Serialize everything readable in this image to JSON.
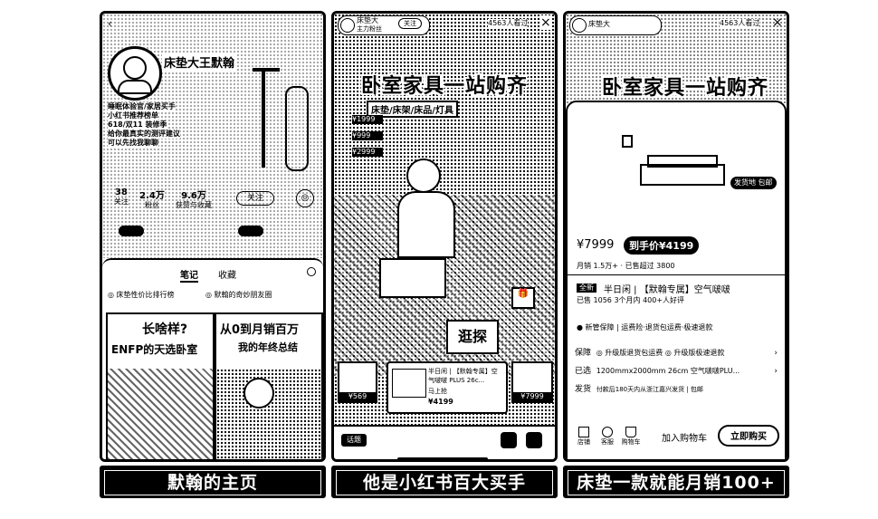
{
  "left": {
    "profile_name": "床垫大王默翰",
    "bio_lines": [
      "睡眠体验官/家居买手",
      "小红书推荐榜单",
      "618/双11 装修季",
      "给你最真实的测评建议",
      "可以先找我聊聊"
    ],
    "stats": [
      {
        "value": "38",
        "label": "关注"
      },
      {
        "value": "2.4万",
        "label": "粉丝"
      },
      {
        "value": "9.6万",
        "label": "获赞与收藏"
      }
    ],
    "follow_label": "关注",
    "chat_label": "◎",
    "tabs": [
      "笔记",
      "收藏"
    ],
    "pinned": [
      "床垫性价比排行榜",
      "默翰的奇妙朋友圈"
    ],
    "card1_text1": "长啥样?",
    "card1_text2": "ENFP的天选卧室",
    "card2_text1": "从0到月销百万",
    "card2_text2": "我的年终总结"
  },
  "middle": {
    "host_name": "床垫大",
    "host_sub": "主力粉丝",
    "follow_label": "关注",
    "viewers": "4563人看过",
    "close_icon": "×",
    "banner": "卧室家具一站购齐",
    "subbanner": "床垫/床架/床品/灯具",
    "price_tags": [
      "¥1999",
      "¥999",
      "¥2999"
    ],
    "sticker": "逛探",
    "product_title": "半日闲 | 【默翰专属】空气啵啵 PLUS 26c...",
    "product_price": "¥4199",
    "product_buy": "马上抢",
    "left_price": "¥569",
    "right_price": "¥7999",
    "bottom_tab": "话题"
  },
  "right": {
    "host_name": "床垫大",
    "viewers": "4563人看过",
    "banner": "卧室家具一站购齐",
    "tag_label": "发货地 包邮",
    "price_original": "¥7999",
    "price_sale": "到手价¥4199",
    "sales_row": "月销 1.5万+ · 已售超过 3800",
    "shop_badge": "全新",
    "product_title": "半日闲 | 【默翰专属】空气啵啵",
    "sold_row": "已售 1056   3个月内 400+人好评",
    "guarantee": "新管保障 | 运费险·退货包运费·极速退款",
    "rows": [
      {
        "key": "保障",
        "value": "◎ 升级版退货包运费   ◎ 升级版极速退款"
      },
      {
        "key": "已选",
        "value": "1200mmx2000mm 26cm 空气啵啵PLU..."
      },
      {
        "key": "发货",
        "value": "付款后180天内从浙江嘉兴发货 | 包邮"
      }
    ],
    "nav": [
      "店铺",
      "客服",
      "购物车"
    ],
    "add_cart": "加入购物车",
    "buy_now": "立即购买"
  },
  "captions": [
    "默翰的主页",
    "他是小红书百大买手",
    "床垫一款就能月销100+"
  ]
}
